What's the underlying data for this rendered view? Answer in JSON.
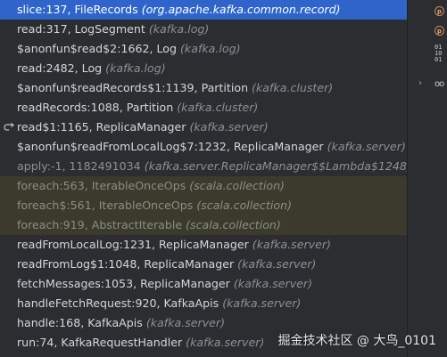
{
  "frames": [
    {
      "method": "slice:137, FileRecords",
      "package": "(org.apache.kafka.common.record)",
      "state": "selected"
    },
    {
      "method": "read:317, LogSegment",
      "package": "(kafka.log)",
      "state": "normal"
    },
    {
      "method": "$anonfun$read$2:1662, Log",
      "package": "(kafka.log)",
      "state": "normal"
    },
    {
      "method": "read:2482, Log",
      "package": "(kafka.log)",
      "state": "normal"
    },
    {
      "method": "$anonfun$readRecords$1:1139, Partition",
      "package": "(kafka.cluster)",
      "state": "normal"
    },
    {
      "method": "readRecords:1088, Partition",
      "package": "(kafka.cluster)",
      "state": "normal"
    },
    {
      "method": "read$1:1165, ReplicaManager",
      "package": "(kafka.server)",
      "state": "normal",
      "icon": "return-arrow-icon"
    },
    {
      "method": "$anonfun$readFromLocalLog$7:1232, ReplicaManager",
      "package": "(kafka.server)",
      "state": "normal"
    },
    {
      "method": "apply:-1, 1182491034",
      "package": "(kafka.server.ReplicaManager$$Lambda$1248)",
      "state": "dim"
    },
    {
      "method": "foreach:563, IterableOnceOps",
      "package": "(scala.collection)",
      "state": "library"
    },
    {
      "method": "foreach$:561, IterableOnceOps",
      "package": "(scala.collection)",
      "state": "library"
    },
    {
      "method": "foreach:919, AbstractIterable",
      "package": "(scala.collection)",
      "state": "library"
    },
    {
      "method": "readFromLocalLog:1231, ReplicaManager",
      "package": "(kafka.server)",
      "state": "normal"
    },
    {
      "method": "readFromLog$1:1048, ReplicaManager",
      "package": "(kafka.server)",
      "state": "normal"
    },
    {
      "method": "fetchMessages:1053, ReplicaManager",
      "package": "(kafka.server)",
      "state": "normal"
    },
    {
      "method": "handleFetchRequest:920, KafkaApis",
      "package": "(kafka.server)",
      "state": "normal"
    },
    {
      "method": "handle:168, KafkaApis",
      "package": "(kafka.server)",
      "state": "normal"
    },
    {
      "method": "run:74, KafkaRequestHandler",
      "package": "(kafka.server)",
      "state": "normal"
    }
  ],
  "side_icons": [
    {
      "icon": "field-p-icon",
      "glyph": "p"
    },
    {
      "icon": "field-p-icon",
      "glyph": "p"
    },
    {
      "icon": "binary-array-icon",
      "glyph": "01\n10\n01"
    },
    {
      "icon": "expand-chevron-icon",
      "glyph": "›"
    },
    {
      "icon": "watch-glasses-icon",
      "glyph": "oo"
    }
  ],
  "watermark": "掘金技术社区 @ 大鸟_0101",
  "colors": {
    "background": "#2b2d30",
    "selected": "#2f65ca",
    "library_highlight": "#3b3a2c"
  }
}
